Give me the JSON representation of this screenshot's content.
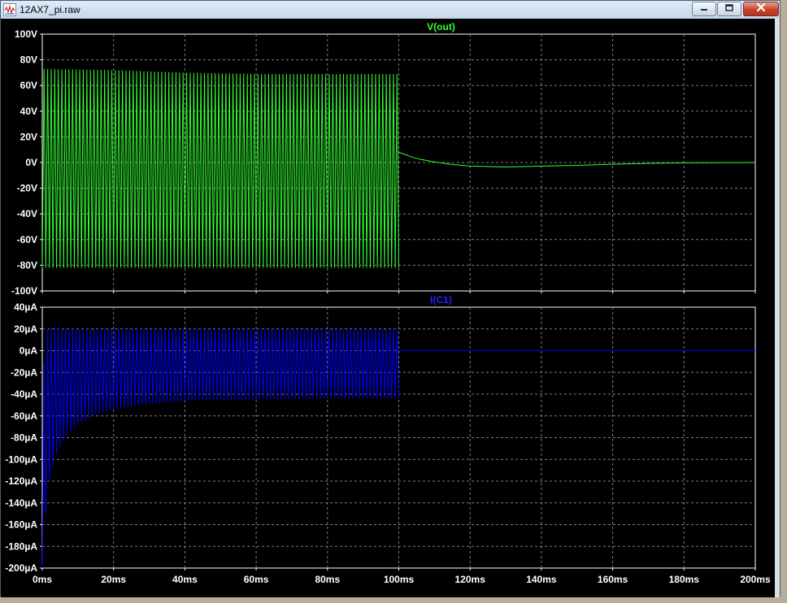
{
  "window": {
    "title": "12AX7_pi.raw",
    "icons": {
      "app": "waveform-app-icon",
      "minimize": "minimize-icon",
      "maximize": "maximize-icon",
      "close": "close-icon"
    }
  },
  "colors": {
    "background": "#000000",
    "axis": "#ffffff",
    "grid": "#808080",
    "trace_vout": "#33ff33",
    "trace_ic1": "#0000ff",
    "tick_text": "#ffffff"
  },
  "chart_data": [
    {
      "type": "line",
      "title": "V(out)",
      "xlim": [
        0,
        200
      ],
      "ylim": [
        -100,
        100
      ],
      "grid": true,
      "x_ticks": [
        "0ms",
        "20ms",
        "40ms",
        "60ms",
        "80ms",
        "100ms",
        "120ms",
        "140ms",
        "160ms",
        "180ms",
        "200ms"
      ],
      "y_ticks": [
        "100V",
        "80V",
        "60V",
        "40V",
        "20V",
        "0V",
        "-20V",
        "-40V",
        "-60V",
        "-80V",
        "-100V"
      ],
      "y_tick_values": [
        100,
        80,
        60,
        40,
        20,
        0,
        -20,
        -40,
        -60,
        -80,
        -100
      ],
      "series": [
        {
          "name": "V(out)",
          "period_ms": 1,
          "segments": [
            {
              "x": [
                0,
                100
              ],
              "max": [
                73,
                72,
                70,
                69,
                69,
                69
              ],
              "min": [
                -82,
                -82,
                -82,
                -82,
                -82,
                -82
              ]
            },
            {
              "x": [
                100,
                102,
                104,
                106,
                110,
                115,
                120,
                130,
                140,
                150,
                160,
                170,
                180,
                200
              ],
              "y": [
                8,
                6,
                4,
                2.5,
                0.5,
                -1.5,
                -2.8,
                -3.5,
                -2.8,
                -2.2,
                -1.3,
                -0.6,
                -0.2,
                0
              ]
            }
          ]
        }
      ]
    },
    {
      "type": "line",
      "title": "I(C1)",
      "xlim": [
        0,
        200
      ],
      "ylim": [
        -200,
        40
      ],
      "grid": true,
      "x_ticks": [
        "0ms",
        "20ms",
        "40ms",
        "60ms",
        "80ms",
        "100ms",
        "120ms",
        "140ms",
        "160ms",
        "180ms",
        "200ms"
      ],
      "y_ticks": [
        "40µA",
        "20µA",
        "0µA",
        "-20µA",
        "-40µA",
        "-60µA",
        "-80µA",
        "-100µA",
        "-120µA",
        "-140µA",
        "-160µA",
        "-180µA",
        "-200µA"
      ],
      "y_tick_values": [
        40,
        20,
        0,
        -20,
        -40,
        -60,
        -80,
        -100,
        -120,
        -140,
        -160,
        -180,
        -200
      ],
      "series": [
        {
          "name": "I(C1)",
          "period_ms": 1,
          "segments": [
            {
              "x": [
                0,
                1,
                2,
                4,
                6,
                8,
                10,
                14,
                20,
                30,
                40,
                60,
                80,
                100
              ],
              "max": [
                -40,
                20,
                21,
                21,
                20,
                20,
                20,
                20,
                20,
                20,
                20,
                20,
                20,
                20
              ],
              "min": [
                -200,
                -150,
                -120,
                -95,
                -82,
                -74,
                -68,
                -60,
                -54,
                -49,
                -46,
                -45,
                -44,
                -44
              ]
            },
            {
              "x": [
                100,
                200
              ],
              "y": [
                0,
                0
              ]
            }
          ]
        }
      ]
    }
  ]
}
